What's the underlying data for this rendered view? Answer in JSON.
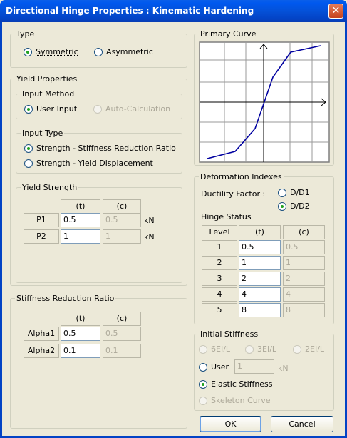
{
  "window": {
    "title": "Directional Hinge Properties : Kinematic Hardening",
    "close_glyph": "✕"
  },
  "type_group": {
    "legend": "Type",
    "symmetric": "Symmetric",
    "asymmetric": "Asymmetric",
    "selected": "Symmetric"
  },
  "yield_props": {
    "legend": "Yield Properties",
    "input_method": {
      "legend": "Input Method",
      "user_input": "User Input",
      "auto_calc": "Auto-Calculation",
      "selected": "User Input"
    },
    "input_type": {
      "legend": "Input Type",
      "opt1": "Strength - Stiffness Reduction Ratio",
      "opt2": "Strength - Yield Displacement",
      "selected": "Strength - Stiffness Reduction Ratio"
    }
  },
  "yield_strength": {
    "legend": "Yield Strength",
    "col_t": "(t)",
    "col_c": "(c)",
    "unit": "kN",
    "rows": [
      {
        "label": "P1",
        "t": "0.5",
        "c": "0.5"
      },
      {
        "label": "P2",
        "t": "1",
        "c": "1"
      }
    ]
  },
  "stiffness_ratio": {
    "legend": "Stiffness Reduction Ratio",
    "col_t": "(t)",
    "col_c": "(c)",
    "rows": [
      {
        "label": "Alpha1",
        "t": "0.5",
        "c": "0.5"
      },
      {
        "label": "Alpha2",
        "t": "0.1",
        "c": "0.1"
      }
    ]
  },
  "primary_curve": {
    "legend": "Primary Curve"
  },
  "deformation": {
    "legend": "Deformation Indexes",
    "ductility_label": "Ductility Factor :",
    "opt_d1": "D/D1",
    "opt_d2": "D/D2",
    "selected": "D/D2",
    "hinge_status": "Hinge Status",
    "col_level": "Level",
    "col_t": "(t)",
    "col_c": "(c)",
    "rows": [
      {
        "level": "1",
        "t": "0.5",
        "c": "0.5"
      },
      {
        "level": "2",
        "t": "1",
        "c": "1"
      },
      {
        "level": "3",
        "t": "2",
        "c": "2"
      },
      {
        "level": "4",
        "t": "4",
        "c": "4"
      },
      {
        "level": "5",
        "t": "8",
        "c": "8"
      }
    ]
  },
  "initial_stiffness": {
    "legend": "Initial Stiffness",
    "opt_6ei": "6EI/L",
    "opt_3ei": "3EI/L",
    "opt_2ei": "2EI/L",
    "opt_user": "User",
    "user_value": "1",
    "user_unit": "kN",
    "opt_elastic": "Elastic Stiffness",
    "opt_skeleton": "Skeleton Curve",
    "selected": "Elastic Stiffness"
  },
  "buttons": {
    "ok": "OK",
    "cancel": "Cancel"
  }
}
